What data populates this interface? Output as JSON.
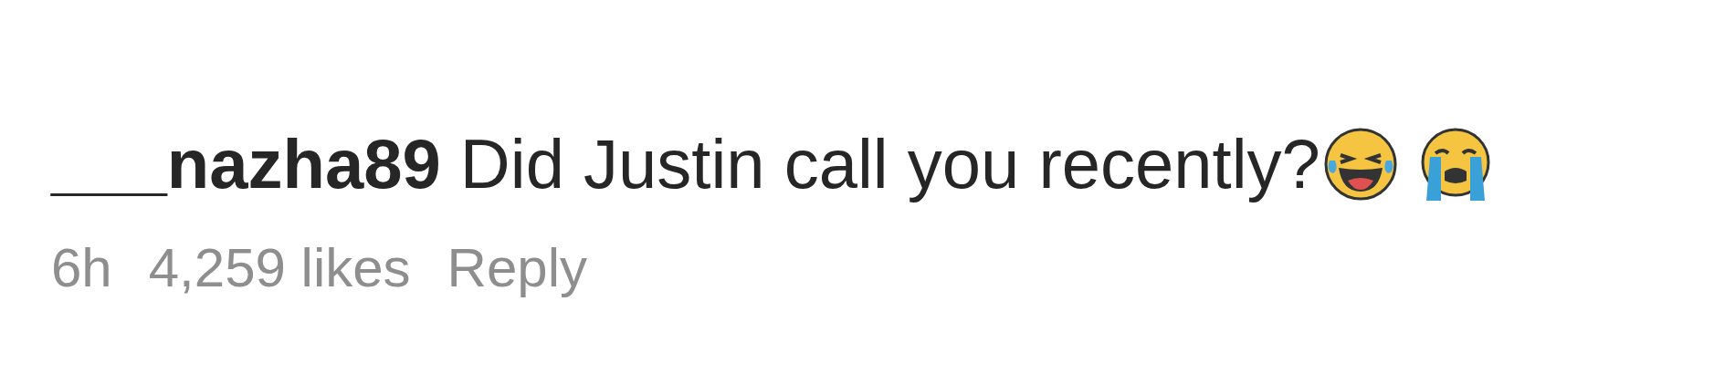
{
  "comment": {
    "username": "___nazha89",
    "text": "Did Justin call you recently?",
    "emojis": [
      {
        "kind": "laughing"
      },
      {
        "kind": "crying"
      }
    ],
    "time": "6h",
    "likes": "4,259 likes",
    "reply": "Reply"
  }
}
